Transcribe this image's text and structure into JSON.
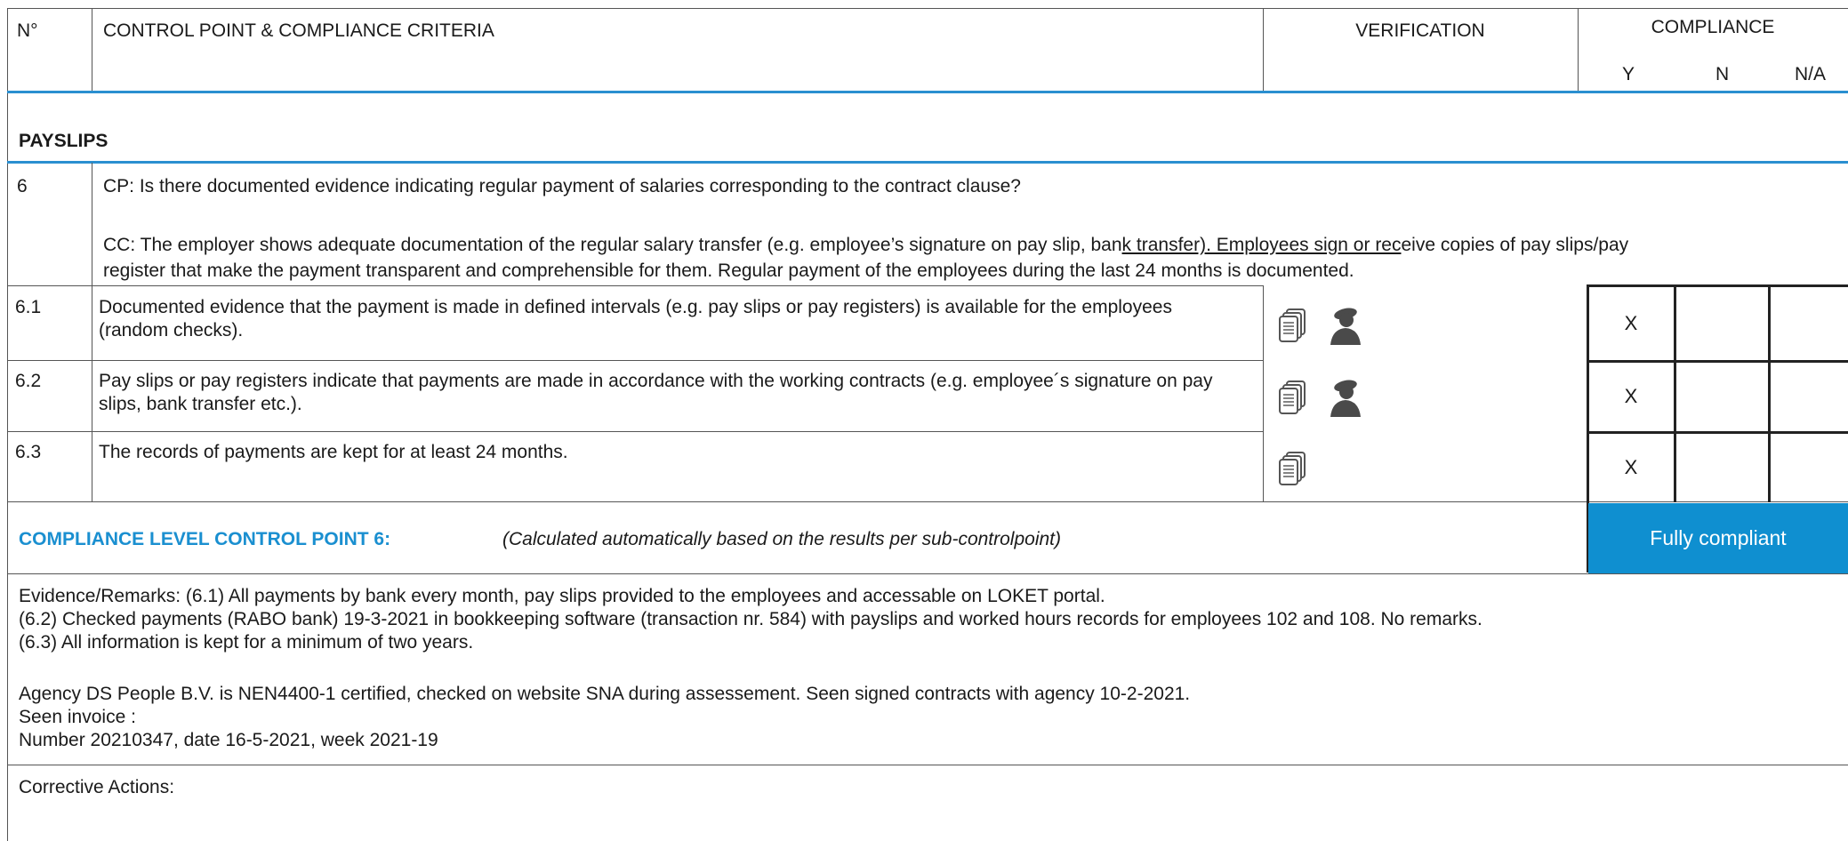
{
  "header": {
    "num_label": "N°",
    "cp_label": "CONTROL POINT & COMPLIANCE CRITERIA",
    "verification_label": "VERIFICATION",
    "compliance_label": "COMPLIANCE",
    "y_label": "Y",
    "n_label": "N",
    "na_label": "N/A"
  },
  "section": {
    "title": "PAYSLIPS"
  },
  "control_point": {
    "number": "6",
    "cp_text": "CP: Is there documented evidence indicating regular payment of salaries corresponding to the contract clause?",
    "cc_line1_a": "CC: The employer shows adequate documentation of the regular salary transfer (e.g. employee’s signature on pay slip, ban",
    "cc_line1_u": "k transfer). Employees sign or rec",
    "cc_line1_b": "eive copies of pay slips/pay",
    "cc_line2": "register that make the payment transparent and comprehensible for them. Regular payment of the employees during the last 24 months is documented."
  },
  "sub_points": [
    {
      "number": "6.1",
      "text": "Documented evidence that the payment is made in defined intervals (e.g. pay slips or pay registers) is available for the employees (random checks).",
      "icons": [
        "document-icon",
        "person-icon"
      ],
      "y": "X",
      "n": "",
      "na": ""
    },
    {
      "number": "6.2",
      "text": "Pay slips or pay registers indicate that payments are made in accordance with the working contracts (e.g. employee´s signature on pay slips, bank transfer etc.).",
      "icons": [
        "document-icon",
        "person-icon"
      ],
      "y": "X",
      "n": "",
      "na": ""
    },
    {
      "number": "6.3",
      "text": "The records of payments are kept for at least 24 months.",
      "icons": [
        "document-icon"
      ],
      "y": "X",
      "n": "",
      "na": ""
    }
  ],
  "compliance_level": {
    "label": "COMPLIANCE LEVEL CONTROL POINT 6:",
    "note": "(Calculated automatically based on the results per sub-controlpoint)",
    "result": "Fully compliant",
    "label_color": "#1a8fd0",
    "badge_color": "#0f8fd0"
  },
  "evidence": {
    "line1": "Evidence/Remarks: (6.1) All payments by bank every month, pay slips provided to the employees and accessable on LOKET portal.",
    "line2": "(6.2) Checked payments (RABO bank) 19-3-2021 in bookkeeping software (transaction nr. 584) with payslips and worked hours records for employees 102 and 108. No remarks.",
    "line3": "(6.3) All information is kept for a minimum of two years.",
    "line4": "Agency DS People B.V. is NEN4400-1 certified, checked on website SNA during assessement. Seen signed contracts with agency 10-2-2021.",
    "line5": "Seen invoice :",
    "line6": "Number 20210347, date 16-5-2021, week 2021-19"
  },
  "corrective": {
    "label": "Corrective Actions:"
  }
}
